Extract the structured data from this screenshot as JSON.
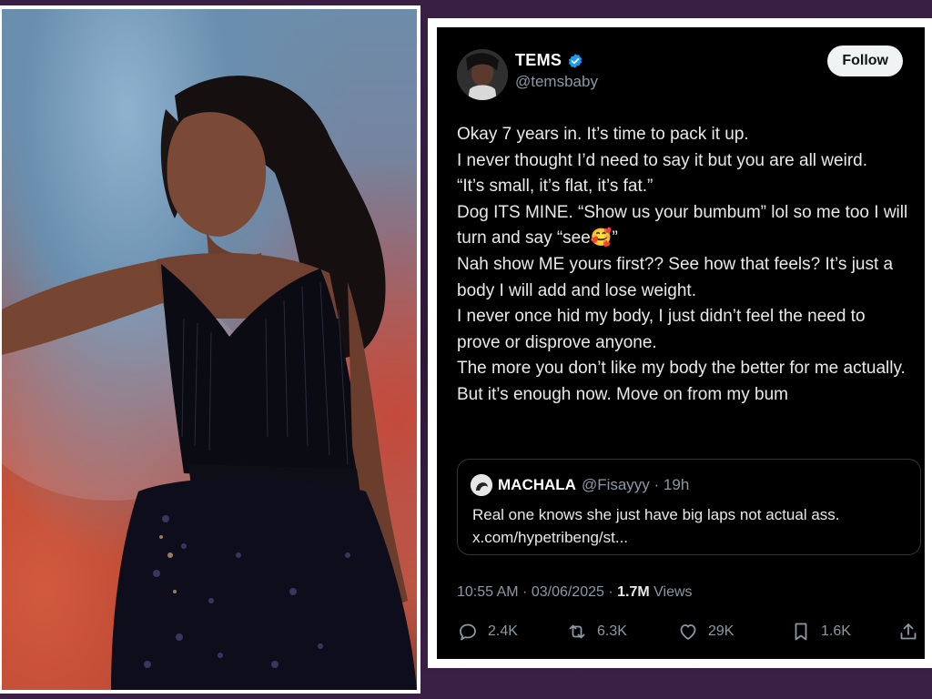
{
  "tweet": {
    "author_name": "TEMS",
    "author_handle": "@temsbaby",
    "follow_label": "Follow",
    "body_lines": [
      "Okay 7 years in. It’s time to pack it up.",
      "I never thought I’d need to say it but you are all weird.",
      "“It’s small, it’s flat, it’s fat.”",
      "Dog ITS MINE. “Show us your bumbum” lol so me too I will turn and say “see🥰”",
      "Nah show ME yours first?? See how that feels? It’s just a body I will add and lose weight.",
      "I never once hid my body, I just didn’t feel the need to prove or disprove anyone.",
      "The more you don’t like my body the better for me actually.",
      "But it’s enough now. Move on from my bum"
    ],
    "quoted": {
      "name": "MACHALA",
      "handle_time": "@Fisayyy · 19h",
      "text_line1": "Real one knows she just have big laps not actual ass.",
      "text_line2": "x.com/hypetribeng/st..."
    },
    "timestamp": "10:55 AM · 03/06/2025 · ",
    "views_count": "1.7M",
    "views_label": " Views",
    "actions": {
      "replies": "2.4K",
      "reposts": "6.3K",
      "likes": "29K",
      "bookmarks": "1.6K"
    }
  },
  "colors": {
    "verified_blue": "#1d9bf0",
    "muted_text": "#8b98a5",
    "card_background": "#000000"
  },
  "icons": [
    "verified-badge-icon",
    "reply-icon",
    "repost-icon",
    "like-icon",
    "bookmark-icon",
    "share-icon"
  ]
}
